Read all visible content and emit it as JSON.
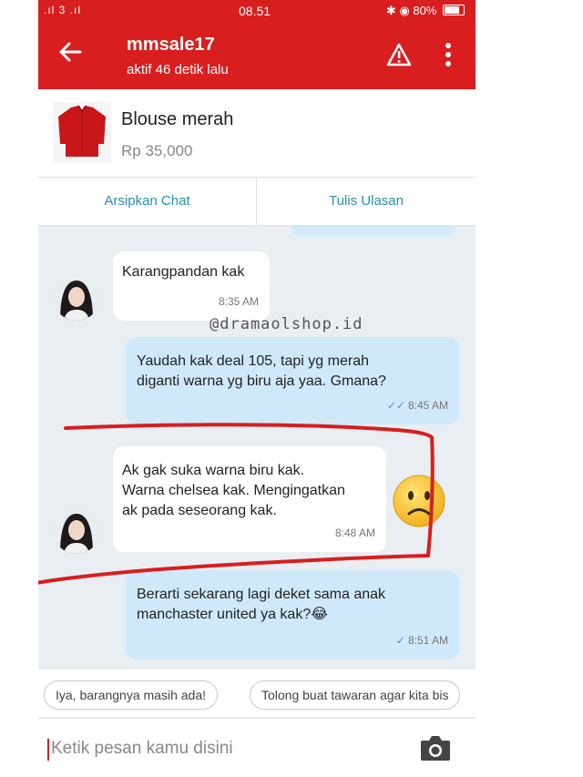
{
  "status_bar": {
    "left_icons": ".ıl 3 .ıl",
    "time": "08.51",
    "battery": "80%"
  },
  "header": {
    "back_icon": "arrow-left-icon",
    "title": "mmsale17",
    "subtitle": "aktif 46 detik lalu"
  },
  "product": {
    "name": "Blouse merah",
    "price": "Rp 35,000",
    "image_icon": "red-blouse-image"
  },
  "actions": {
    "archive": "Arsipkan Chat",
    "review": "Tulis Ulasan"
  },
  "watermark": "@dramaolshop.id",
  "messages": [
    {
      "direction": "in",
      "text": "Karangpandan kak",
      "time": "8:35 AM"
    },
    {
      "direction": "out",
      "text": "Yaudah kak deal 105, tapi yg merah\ndiganti warna yg biru aja yaa. Gmana?",
      "time": "8:45 AM"
    },
    {
      "direction": "in",
      "text": "Ak gak suka warna biru kak.\nWarna chelsea kak. Mengingatkan\nak pada seseorang kak.",
      "time": "8:48 AM"
    },
    {
      "direction": "out",
      "text": "Berarti sekarang lagi deket sama anak\nmanchaster united ya kak?😂",
      "time": "8:51 AM"
    }
  ],
  "suggestions": [
    "Iya, barangnya masih ada!",
    "Tolong buat tawaran agar kita bis"
  ],
  "input": {
    "placeholder": "Ketik pesan kamu disini"
  },
  "colors": {
    "brand": "#d81e1e",
    "accent": "#2a8fb6",
    "bubble_out": "#cfe9fa",
    "annotation": "#d81e1e"
  }
}
